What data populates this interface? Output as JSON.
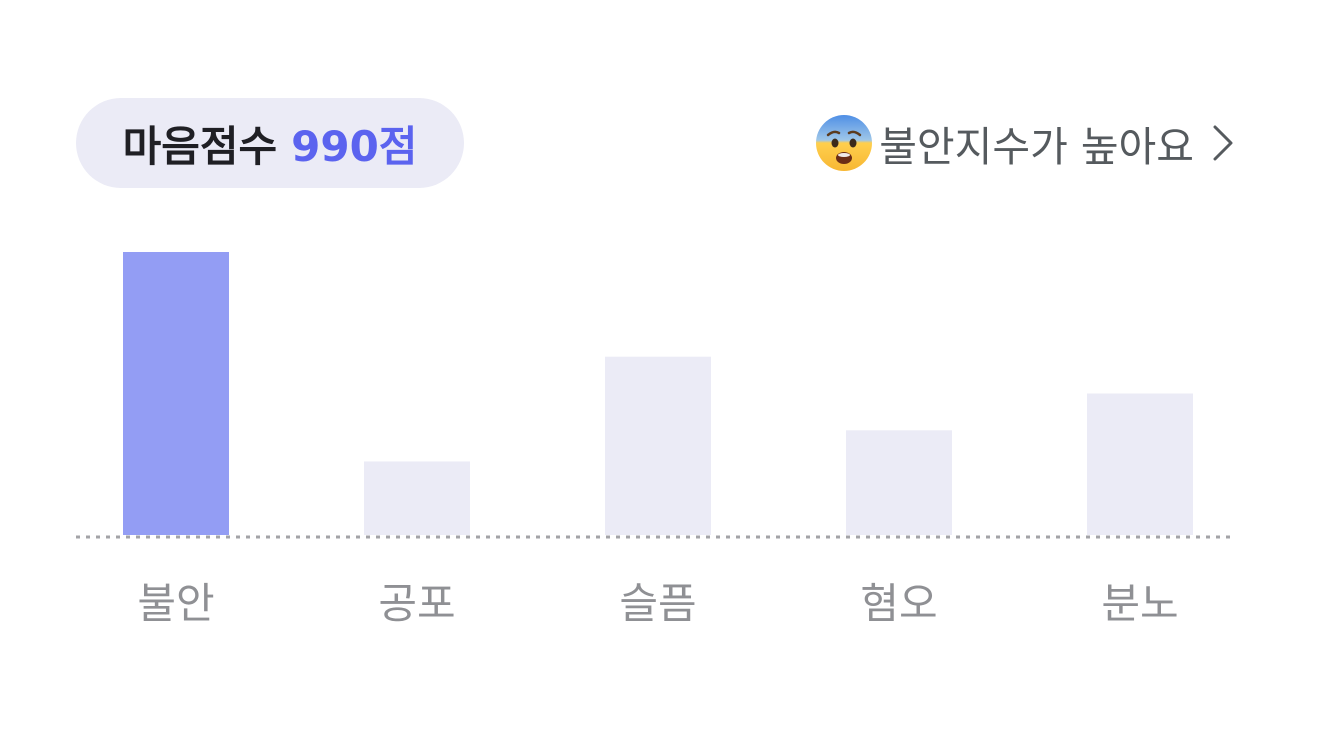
{
  "header": {
    "score_label": "마음점수",
    "score_value": "990점",
    "status_text": "불안지수가 높아요",
    "status_icon": "anxious-face-icon",
    "chevron_icon": "chevron-right-icon"
  },
  "colors": {
    "highlight_bar": "#939df4",
    "default_bar": "#ebebf6",
    "score_accent": "#5b63ef",
    "pill_background": "#ebebf6",
    "baseline": "#a3a3a7"
  },
  "chart_data": {
    "type": "bar",
    "categories": [
      "불안",
      "공포",
      "슬픔",
      "혐오",
      "분노"
    ],
    "values": [
      100,
      26,
      63,
      37,
      50
    ],
    "highlighted_category": "불안",
    "ylim": [
      0,
      100
    ],
    "grid": false,
    "baseline": "dotted"
  }
}
